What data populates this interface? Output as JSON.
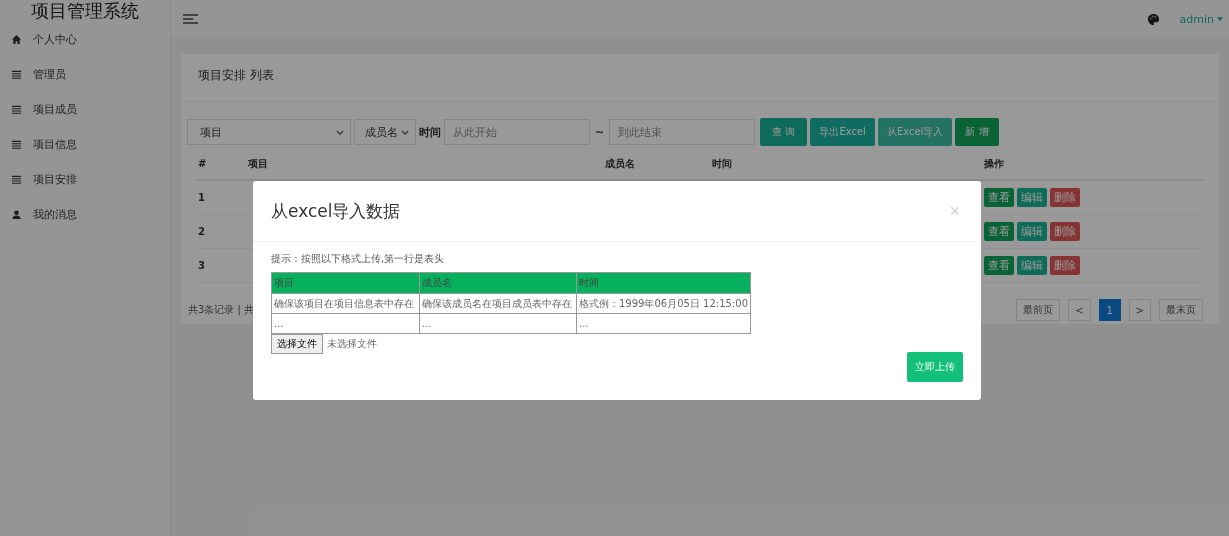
{
  "app_title": "项目管理系统",
  "sidebar": {
    "items": [
      {
        "label": "个人中心",
        "kind": "home"
      },
      {
        "label": "管理员",
        "kind": "list"
      },
      {
        "label": "项目成员",
        "kind": "list"
      },
      {
        "label": "项目信息",
        "kind": "list"
      },
      {
        "label": "项目安排",
        "kind": "list"
      },
      {
        "label": "我的消息",
        "kind": "user"
      }
    ]
  },
  "topbar": {
    "user": "admin"
  },
  "panel": {
    "title": "项目安排 列表",
    "filters": {
      "project_select": "项目",
      "member_select": "成员名",
      "time_label": "时间",
      "start_placeholder": "从此开始",
      "separator": "~",
      "end_placeholder": "到此结束"
    },
    "buttons": [
      {
        "label": "查 询",
        "kind": "query"
      },
      {
        "label": "导出Excel",
        "kind": "export"
      },
      {
        "label": "从Excel导入",
        "kind": "import"
      },
      {
        "label": "新 增",
        "kind": "add"
      }
    ],
    "table": {
      "columns": [
        "#",
        "项目",
        "成员名",
        "时间",
        "操作"
      ],
      "rows": [
        {
          "number": "1",
          "actions": [
            {
              "label": "查看",
              "kind": "view"
            },
            {
              "label": "编辑",
              "kind": "edit"
            },
            {
              "label": "删除",
              "kind": "delete"
            }
          ]
        },
        {
          "number": "2",
          "actions": [
            {
              "label": "查看",
              "kind": "view"
            },
            {
              "label": "编辑",
              "kind": "edit"
            },
            {
              "label": "删除",
              "kind": "delete"
            }
          ]
        },
        {
          "number": "3",
          "actions": [
            {
              "label": "查看",
              "kind": "view"
            },
            {
              "label": "编辑",
              "kind": "edit"
            },
            {
              "label": "删除",
              "kind": "delete"
            }
          ]
        }
      ]
    },
    "record_summary": "共3条记录 | 共",
    "pagination": [
      {
        "label": "最前页",
        "selected": false
      },
      {
        "label": "<",
        "selected": false
      },
      {
        "label": "1",
        "selected": true
      },
      {
        "label": ">",
        "selected": false
      },
      {
        "label": "最末页",
        "selected": false
      }
    ]
  },
  "modal": {
    "title": "从excel导入数据",
    "close": "×",
    "hint": "提示：按照以下格式上传,第一行是表头",
    "columns": [
      "项目",
      "成员名",
      "时间"
    ],
    "rows": [
      [
        "确保该项目在项目信息表中存在",
        "确保该成员名在项目成员表中存在",
        "格式例：1999年06月05日 12:15:00"
      ],
      [
        "...",
        "...",
        "..."
      ]
    ],
    "file_button": "选择文件",
    "file_status": "未选择文件",
    "submit": "立即上传"
  }
}
